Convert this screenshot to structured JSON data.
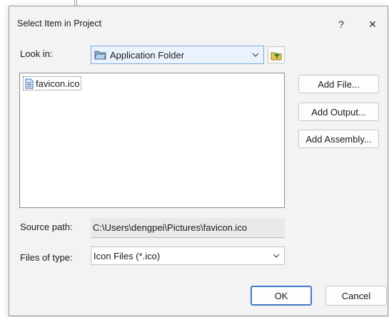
{
  "dialog": {
    "title": "Select Item in Project",
    "help_glyph": "?",
    "close_glyph": "✕"
  },
  "look_in": {
    "label": "Look in:",
    "value": "Application Folder",
    "folder_icon": "folder-icon",
    "up_icon": "folder-up-icon"
  },
  "files": [
    {
      "name": "favicon.ico",
      "icon": "file-icon",
      "focused": true
    }
  ],
  "side_buttons": {
    "add_file": "Add File...",
    "add_output": "Add Output...",
    "add_assembly": "Add Assembly..."
  },
  "source_path": {
    "label": "Source path:",
    "value": "C:\\Users\\dengpei\\Pictures\\favicon.ico"
  },
  "file_type": {
    "label": "Files of type:",
    "value": "Icon Files (*.ico)"
  },
  "footer": {
    "ok": "OK",
    "cancel": "Cancel"
  },
  "colors": {
    "accent": "#3f78c7",
    "dialog_bg": "#f3f3f3",
    "combo_focus_bg": "#eaf3fd"
  }
}
